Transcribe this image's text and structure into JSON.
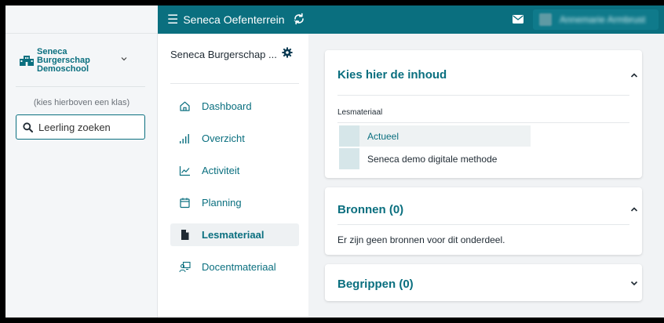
{
  "topbar": {
    "environment": "Seneca Oefenterrein",
    "user_name": "Annemarie Armbrust"
  },
  "sidebar": {
    "school_line1": "Seneca",
    "school_line2": "Burgerschap",
    "school_line3": "Demoschool",
    "hint": "(kies hierboven een klas)",
    "search_placeholder": "Leerling zoeken"
  },
  "nav": {
    "title": "Seneca Burgerschap ...",
    "items": [
      {
        "label": "Dashboard",
        "icon": "home-icon"
      },
      {
        "label": "Overzicht",
        "icon": "bar-chart-icon"
      },
      {
        "label": "Activiteit",
        "icon": "activity-chart-icon"
      },
      {
        "label": "Planning",
        "icon": "calendar-icon"
      },
      {
        "label": "Lesmateriaal",
        "icon": "file-icon",
        "active": true
      },
      {
        "label": "Docentmateriaal",
        "icon": "teacher-icon"
      }
    ]
  },
  "main": {
    "inhoud": {
      "title": "Kies hier de inhoud",
      "section_label": "Lesmateriaal",
      "items": [
        {
          "label": "Actueel",
          "selected": true
        },
        {
          "label": "Seneca demo digitale methode",
          "selected": false
        }
      ]
    },
    "bronnen": {
      "title": "Bronnen (0)",
      "text": "Er zijn geen bronnen voor dit onderdeel."
    },
    "begrippen": {
      "title": "Begrippen (0)"
    }
  },
  "colors": {
    "brand": "#0a6f7f",
    "background": "#f1f3f5"
  }
}
